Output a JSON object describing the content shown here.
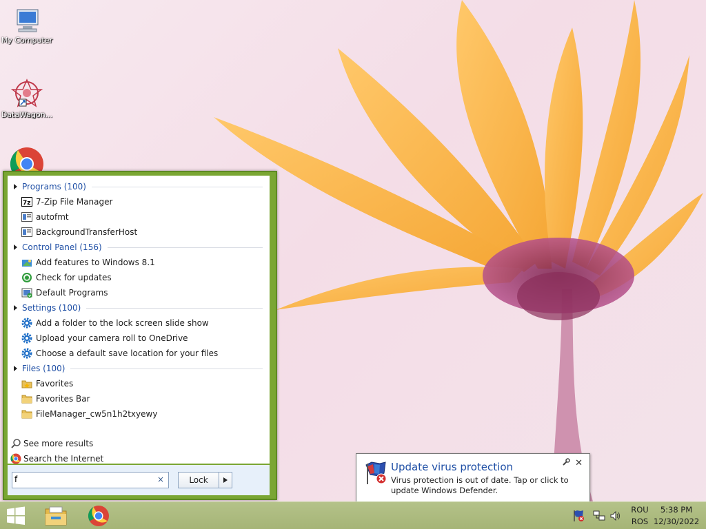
{
  "desktop": {
    "icons": [
      {
        "label": "My Computer"
      },
      {
        "label": "DataWagon..."
      }
    ]
  },
  "start_menu": {
    "groups": [
      {
        "label": "Programs (100)",
        "items": [
          "7-Zip File Manager",
          "autofmt",
          "BackgroundTransferHost"
        ]
      },
      {
        "label": "Control Panel (156)",
        "items": [
          "Add features to Windows 8.1",
          "Check for updates",
          "Default Programs"
        ]
      },
      {
        "label": "Settings (100)",
        "items": [
          "Add a folder to the lock screen slide show",
          "Upload your camera roll to OneDrive",
          "Choose a default save location for your files"
        ]
      },
      {
        "label": "Files (100)",
        "items": [
          "Favorites",
          "Favorites Bar",
          "FileManager_cw5n1h2txyewy"
        ]
      }
    ],
    "see_more": "See more results",
    "search_internet": "Search the Internet",
    "search_value": "f",
    "clear_glyph": "×",
    "lock_label": "Lock"
  },
  "notification": {
    "title": "Update virus protection",
    "body": "Virus protection is out of date. Tap or click to update Windows Defender.",
    "close_glyph": "✕"
  },
  "taskbar": {
    "language_top": "ROU",
    "language_bottom": "ROS",
    "time": "5:38 PM",
    "date": "12/30/2022"
  },
  "colors": {
    "start_menu_frame": "#7aa633",
    "link_blue": "#1f4fa5",
    "taskbar": "#a8b87a"
  }
}
